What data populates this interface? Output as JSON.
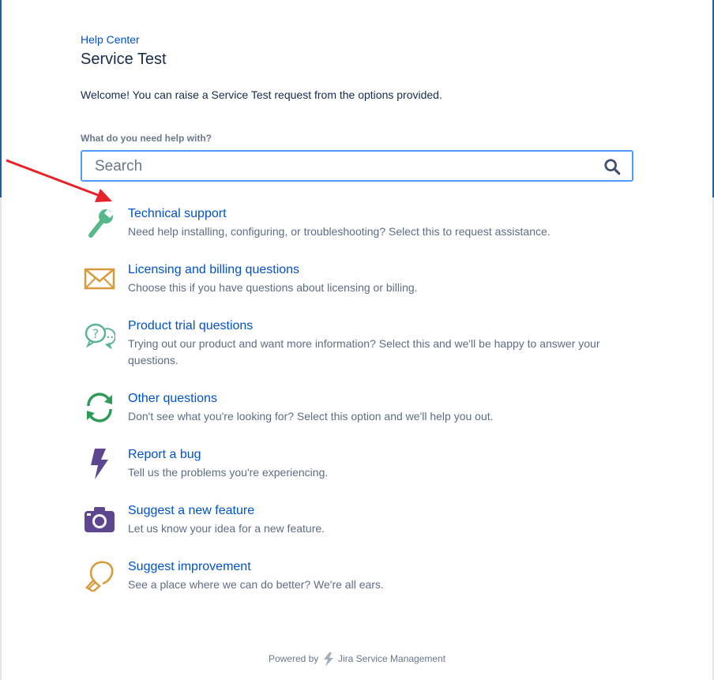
{
  "breadcrumb": "Help Center",
  "page_title": "Service Test",
  "welcome": "Welcome! You can raise a Service Test request from the options provided.",
  "search": {
    "label": "What do you need help with?",
    "placeholder": "Search"
  },
  "request_types": [
    {
      "title": "Technical support",
      "description": "Need help installing, configuring, or troubleshooting? Select this to request assistance.",
      "icon": "wrench-icon",
      "color": "#57b88a"
    },
    {
      "title": "Licensing and billing questions",
      "description": "Choose this if you have questions about licensing or billing.",
      "icon": "envelope-icon",
      "color": "#d89a3a"
    },
    {
      "title": "Product trial questions",
      "description": "Trying out our product and want more information? Select this and we'll be happy to answer your questions.",
      "icon": "question-bubbles-icon",
      "color": "#5cb39a"
    },
    {
      "title": "Other questions",
      "description": "Don't see what you're looking for? Select this option and we'll help you out.",
      "icon": "refresh-arrows-icon",
      "color": "#2e9b57"
    },
    {
      "title": "Report a bug",
      "description": "Tell us the problems you're experiencing.",
      "icon": "lightning-bolt-icon",
      "color": "#5e4590"
    },
    {
      "title": "Suggest a new feature",
      "description": "Let us know your idea for a new feature.",
      "icon": "camera-icon",
      "color": "#5e4590"
    },
    {
      "title": "Suggest improvement",
      "description": "See a place where we can do better? We're all ears.",
      "icon": "lightbulb-icon",
      "color": "#d89a3a"
    }
  ],
  "footer": {
    "prefix": "Powered by",
    "product": "Jira Service Management"
  },
  "colors": {
    "link": "#0052cc",
    "frame_border": "#1d5fa0",
    "search_border": "#4c9aff",
    "annotation_arrow": "#e8222a"
  }
}
